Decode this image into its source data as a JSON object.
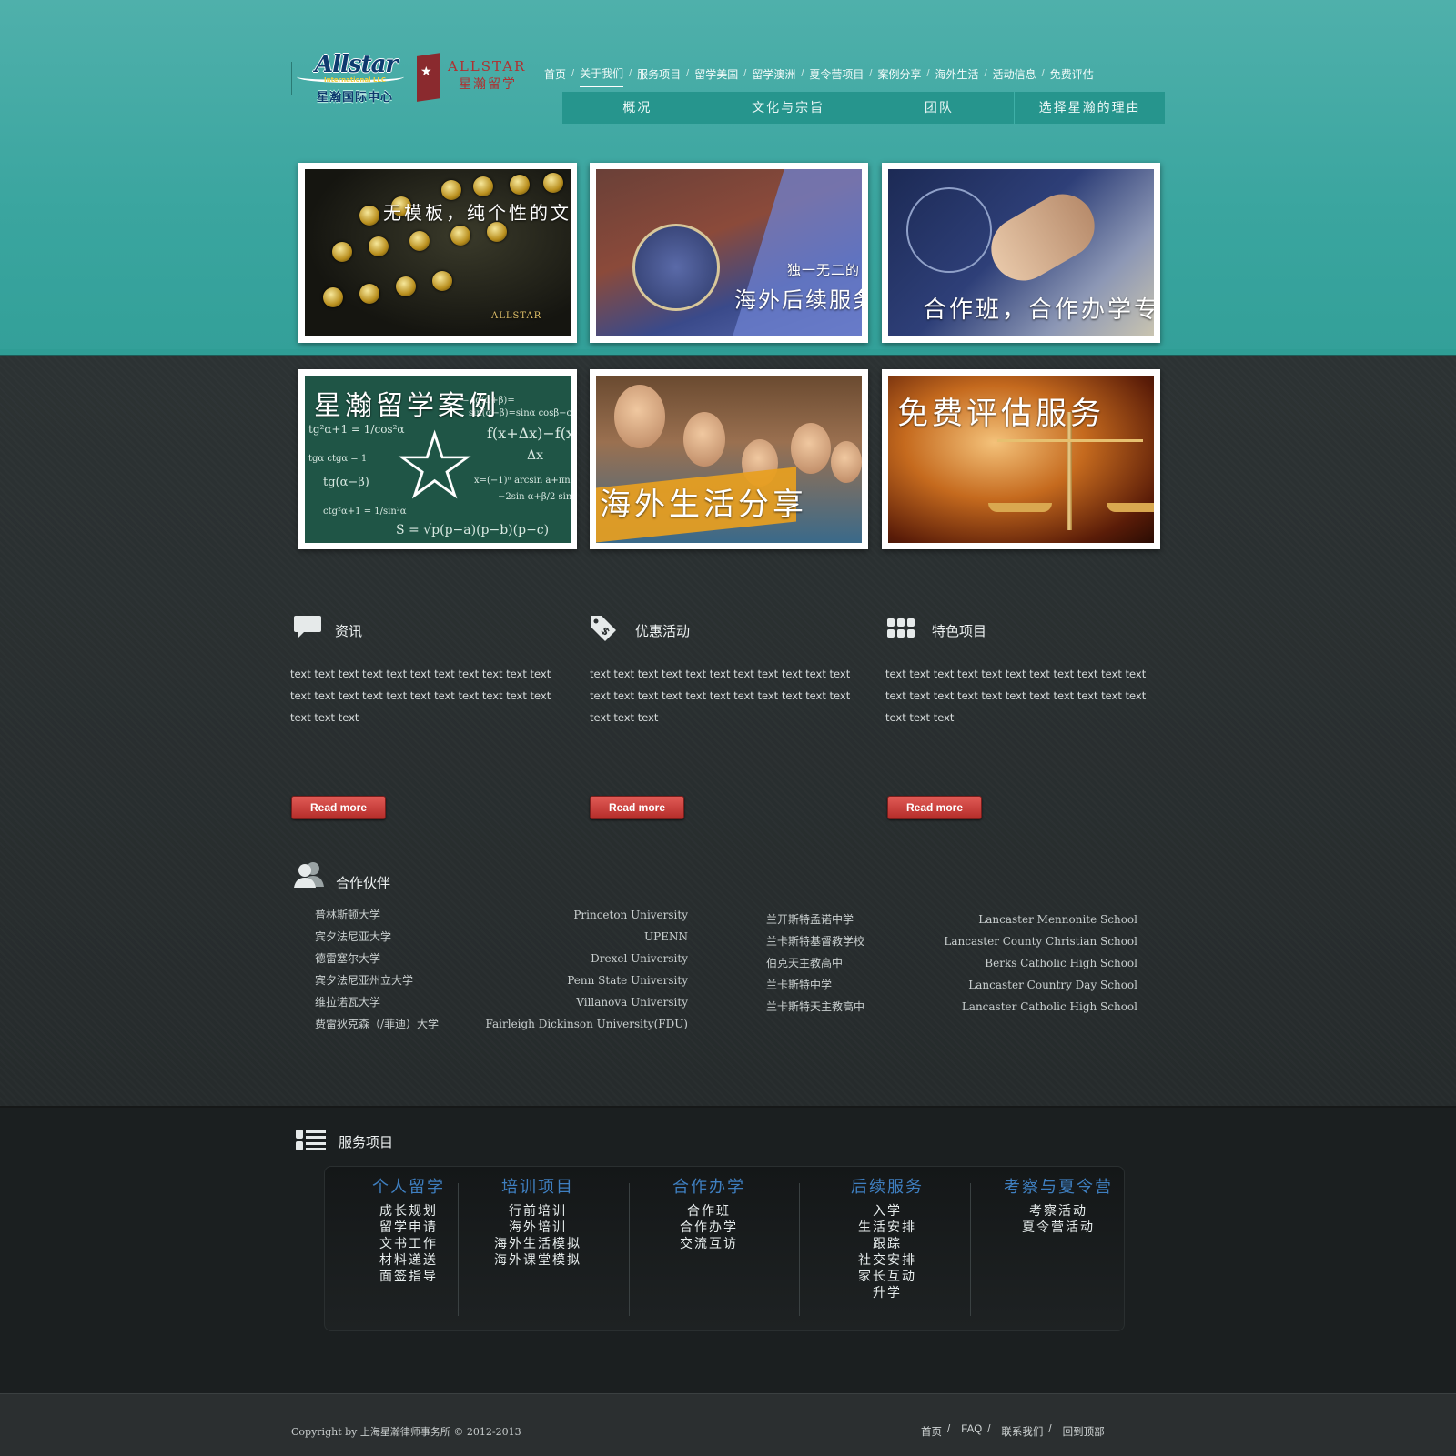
{
  "logo": {
    "brand_en": "Allstar",
    "brand_llc": "International LLC",
    "brand_cn": "星瀚国际中心",
    "brand2_en": "ALLSTAR",
    "brand2_cn": "星瀚留学"
  },
  "nav": {
    "items": [
      "首页",
      "关于我们",
      "服务项目",
      "留学美国",
      "留学澳洲",
      "夏令营项目",
      "案例分享",
      "海外生活",
      "活动信息",
      "免费评估"
    ],
    "active_index": 1
  },
  "subnav": {
    "items": [
      "概况",
      "文化与宗旨",
      "团队",
      "选择星瀚的理由"
    ]
  },
  "cards": {
    "c1": {
      "caption": "无模板，纯个性的文书",
      "badge": "ALLSTAR"
    },
    "c2": {
      "caption_small": "独一无二的",
      "caption": "海外后续服务"
    },
    "c3": {
      "caption": "合作班，合作办学专区"
    },
    "c4": {
      "caption": "星瀚留学案例"
    },
    "c5": {
      "caption": "海外生活分享"
    },
    "c6": {
      "caption": "免费评估服务"
    }
  },
  "info": {
    "news": {
      "title": "资讯",
      "icon": "speech-bubble-icon",
      "text": "text text text text text text text text text text text text text text text text text text text text text text text text text",
      "button": "Read more"
    },
    "promo": {
      "title": "优惠活动",
      "icon": "price-tag-icon",
      "text": "text text text text text text text text text text text text text text text text text text text text text text text text text",
      "button": "Read more"
    },
    "featured": {
      "title": "特色项目",
      "icon": "grid-icon",
      "text": "text text text text text text text text text text text text text text text text text text text text text text text text text",
      "button": "Read more"
    }
  },
  "partners": {
    "title": "合作伙伴",
    "icon": "users-icon",
    "universities_cn": [
      "普林斯顿大学",
      "宾夕法尼亚大学",
      "德雷塞尔大学",
      "宾夕法尼亚州立大学",
      "维拉诺瓦大学",
      "费雷狄克森（/菲迪）大学"
    ],
    "universities_en": [
      "Princeton University",
      "UPENN",
      "Drexel University",
      "Penn State University",
      "Villanova University",
      "Fairleigh Dickinson University(FDU)"
    ],
    "schools_cn": [
      "兰开斯特孟诺中学",
      "兰卡斯特基督教学校",
      "伯克天主教高中",
      "兰卡斯特中学",
      "兰卡斯特天主教高中"
    ],
    "schools_en": [
      "Lancaster Mennonite School",
      "Lancaster County Christian School",
      "Berks Catholic High School",
      "Lancaster Country Day School",
      "Lancaster Catholic High School"
    ]
  },
  "services": {
    "title": "服务项目",
    "icon": "list-icon",
    "columns": [
      {
        "heading": "个人留学",
        "items": [
          "成长规划",
          "留学申请",
          "文书工作",
          "材料递送",
          "面签指导"
        ]
      },
      {
        "heading": "培训项目",
        "items": [
          "行前培训",
          "海外培训",
          "海外生活模拟",
          "海外课堂模拟"
        ]
      },
      {
        "heading": "合作办学",
        "items": [
          "合作班",
          "合作办学",
          "交流互访"
        ]
      },
      {
        "heading": "后续服务",
        "items": [
          "入学",
          "生活安排",
          "跟踪",
          "社交安排",
          "家长互动",
          "升学"
        ]
      },
      {
        "heading": "考察与夏令营",
        "items": [
          "考察活动",
          "夏令营活动"
        ]
      }
    ]
  },
  "footer": {
    "copyright": "Copyright by 上海星瀚律师事务所 © 2012-2013",
    "links": [
      "首页",
      "FAQ",
      "联系我们",
      "回到顶部"
    ],
    "separator": "/"
  },
  "colors": {
    "header_teal": "#3aa59f",
    "subnav_teal": "#26958d",
    "body_dark": "#262b2c",
    "button_red": "#c0392b",
    "service_heading_blue": "#3f7fc0"
  }
}
